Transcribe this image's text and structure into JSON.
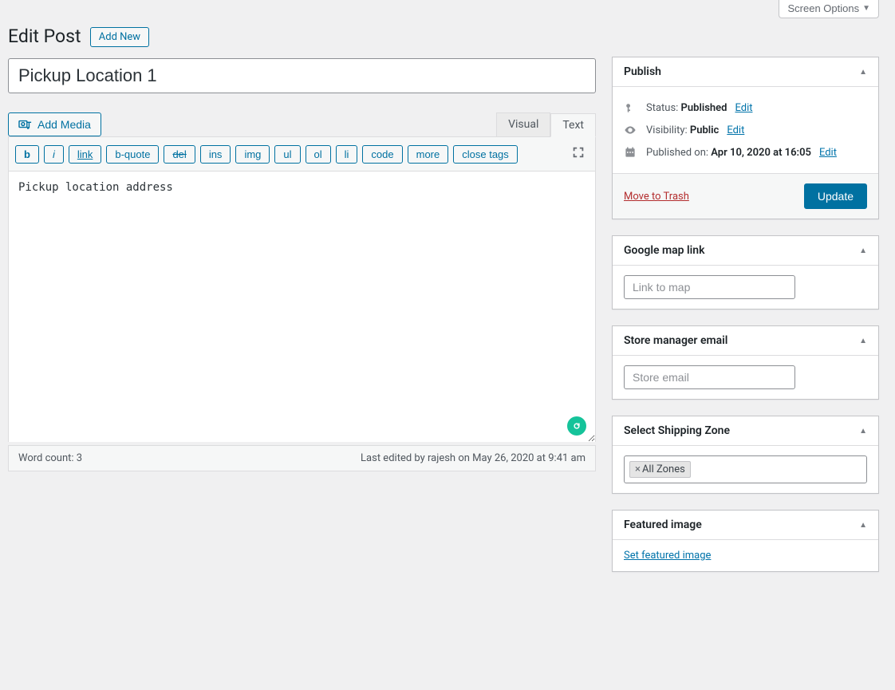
{
  "screen_options": "Screen Options",
  "page": {
    "heading": "Edit Post",
    "add_new": "Add New"
  },
  "post": {
    "title": "Pickup Location 1",
    "content": "Pickup location address"
  },
  "editor": {
    "add_media": "Add Media",
    "tabs": {
      "visual": "Visual",
      "text": "Text"
    },
    "quicktags": {
      "b": "b",
      "i": "i",
      "link": "link",
      "bquote": "b-quote",
      "del": "del",
      "ins": "ins",
      "img": "img",
      "ul": "ul",
      "ol": "ol",
      "li": "li",
      "code": "code",
      "more": "more",
      "close": "close tags"
    },
    "wordcount_label": "Word count: ",
    "wordcount": "3",
    "last_edit": "Last edited by rajesh on May 26, 2020 at 9:41 am"
  },
  "publish": {
    "box_title": "Publish",
    "status_label": "Status: ",
    "status_value": "Published",
    "visibility_label": "Visibility: ",
    "visibility_value": "Public",
    "published_label": "Published on: ",
    "published_value": "Apr 10, 2020 at 16:05",
    "edit": "Edit",
    "trash": "Move to Trash",
    "update": "Update"
  },
  "gmap": {
    "box_title": "Google map link",
    "placeholder": "Link to map"
  },
  "store_email": {
    "box_title": "Store manager email",
    "placeholder": "Store email"
  },
  "zone": {
    "box_title": "Select Shipping Zone",
    "tag": "All Zones"
  },
  "featured": {
    "box_title": "Featured image",
    "link": "Set featured image"
  }
}
